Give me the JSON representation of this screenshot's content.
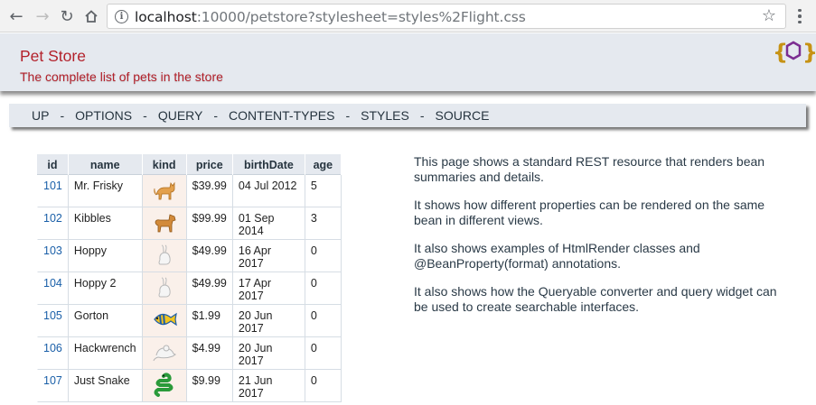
{
  "browser": {
    "url_host": "localhost",
    "url_rest": ":10000/petstore?stylesheet=styles%2Flight.css"
  },
  "header": {
    "title": "Pet Store",
    "subtitle": "The complete list of pets in the store"
  },
  "nav": {
    "items": [
      "UP",
      "OPTIONS",
      "QUERY",
      "CONTENT-TYPES",
      "STYLES",
      "SOURCE"
    ],
    "separator": "-"
  },
  "table": {
    "columns": [
      "id",
      "name",
      "kind",
      "price",
      "birthDate",
      "age"
    ],
    "rows": [
      {
        "id": "101",
        "name": "Mr. Frisky",
        "kind": "cat",
        "price": "$39.99",
        "birthDate": "04 Jul 2012",
        "age": "5"
      },
      {
        "id": "102",
        "name": "Kibbles",
        "kind": "dog",
        "price": "$99.99",
        "birthDate": "01 Sep 2014",
        "age": "3"
      },
      {
        "id": "103",
        "name": "Hoppy",
        "kind": "rabbit",
        "price": "$49.99",
        "birthDate": "16 Apr 2017",
        "age": "0"
      },
      {
        "id": "104",
        "name": "Hoppy 2",
        "kind": "rabbit",
        "price": "$49.99",
        "birthDate": "17 Apr 2017",
        "age": "0"
      },
      {
        "id": "105",
        "name": "Gorton",
        "kind": "fish",
        "price": "$1.99",
        "birthDate": "20 Jun 2017",
        "age": "0"
      },
      {
        "id": "106",
        "name": "Hackwrench",
        "kind": "mouse",
        "price": "$4.99",
        "birthDate": "20 Jun 2017",
        "age": "0"
      },
      {
        "id": "107",
        "name": "Just Snake",
        "kind": "snake",
        "price": "$9.99",
        "birthDate": "21 Jun 2017",
        "age": "0"
      }
    ]
  },
  "description": [
    "This page shows a standard REST resource that renders bean summaries and details.",
    "It shows how different properties can be rendered on the same bean in different views.",
    "It also shows examples of HtmlRender classes and @BeanProperty(format) annotations.",
    "It also shows how the Queryable converter and query widget can be used to create searchable interfaces."
  ],
  "colors": {
    "title": "#b3212b",
    "header_bg": "#e5e9ef",
    "id_link": "#1a5fa8",
    "kind_cell_bg": "#faf0ea"
  }
}
